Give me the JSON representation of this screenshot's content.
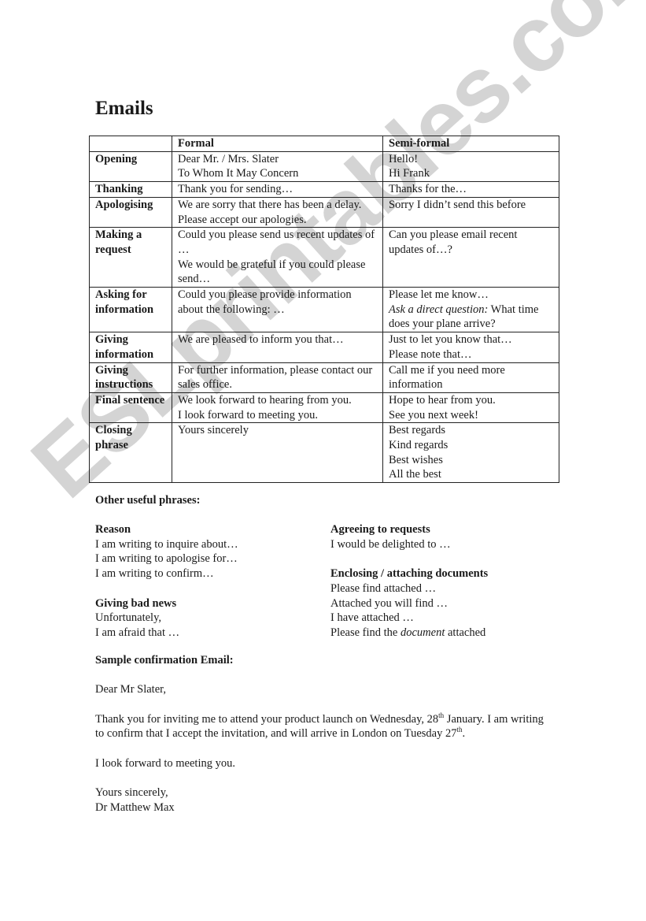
{
  "document": {
    "title": "Emails",
    "watermark": "ESLprintables.com"
  },
  "table": {
    "headers": [
      "",
      "Formal",
      "Semi-formal"
    ],
    "rows": [
      {
        "label": "Opening",
        "formal": [
          "Dear Mr. / Mrs. Slater",
          "To Whom It May Concern"
        ],
        "semi": [
          "Hello!",
          "Hi Frank"
        ]
      },
      {
        "label": "Thanking",
        "formal": [
          "Thank you for sending…"
        ],
        "semi": [
          "Thanks for the…"
        ]
      },
      {
        "label": "Apologising",
        "formal": [
          "We are sorry that there has been a delay. Please accept our apologies."
        ],
        "semi": [
          "Sorry I didn’t send this before"
        ]
      },
      {
        "label": "Making a request",
        "formal": [
          "Could you please send us recent updates of …",
          "We would be grateful if you could please send…"
        ],
        "semi": [
          "Can you please email recent updates of…?"
        ]
      },
      {
        "label": "Asking for information",
        "formal": [
          "Could you please provide information about the following: …"
        ],
        "semi_first": "Please let me know…",
        "semi_italic": "Ask a direct question:",
        "semi_rest": " What time does your plane arrive?"
      },
      {
        "label": "Giving information",
        "formal": [
          "We are pleased to inform you that…"
        ],
        "semi": [
          "Just to let you know that…",
          "Please note that…"
        ]
      },
      {
        "label": "Giving instructions",
        "formal": [
          "For further information, please contact our sales office."
        ],
        "semi": [
          "Call me if you need more information"
        ]
      },
      {
        "label": "Final sentence",
        "formal": [
          "We look forward to hearing from you.",
          "I look forward to meeting you."
        ],
        "semi": [
          "Hope to hear from you.",
          "See you next week!"
        ]
      },
      {
        "label": "Closing phrase",
        "formal": [
          "Yours sincerely"
        ],
        "semi": [
          "Best regards",
          "Kind regards",
          "Best wishes",
          "All the best"
        ]
      }
    ]
  },
  "useful_phrases": {
    "heading": "Other useful phrases:",
    "reason": {
      "heading": "Reason",
      "items": [
        "I am writing to inquire about…",
        "I am writing to apologise for…",
        "I am writing to confirm…"
      ]
    },
    "bad_news": {
      "heading": "Giving bad news",
      "items": [
        "Unfortunately,",
        "I am afraid that …"
      ]
    },
    "agreeing": {
      "heading": "Agreeing to requests",
      "items": [
        "I would be delighted to …"
      ]
    },
    "enclosing": {
      "heading": "Enclosing / attaching documents",
      "items": [
        "Please find attached …",
        "Attached you will find …",
        "I have attached …"
      ],
      "last_prefix": "Please find the ",
      "last_italic": "document",
      "last_suffix": " attached"
    }
  },
  "sample": {
    "heading": "Sample confirmation Email:",
    "greeting": "Dear Mr Slater,",
    "body_1": "Thank you for inviting me to attend your product launch on Wednesday, 28",
    "sup_1": "th",
    "body_2": " January. I am writing to confirm that I accept the invitation, and will arrive in London on Tuesday 27",
    "sup_2": "th",
    "body_3": ".",
    "closing_line": "I look forward to meeting you.",
    "signoff": "Yours sincerely,",
    "signature": "Dr Matthew Max"
  }
}
